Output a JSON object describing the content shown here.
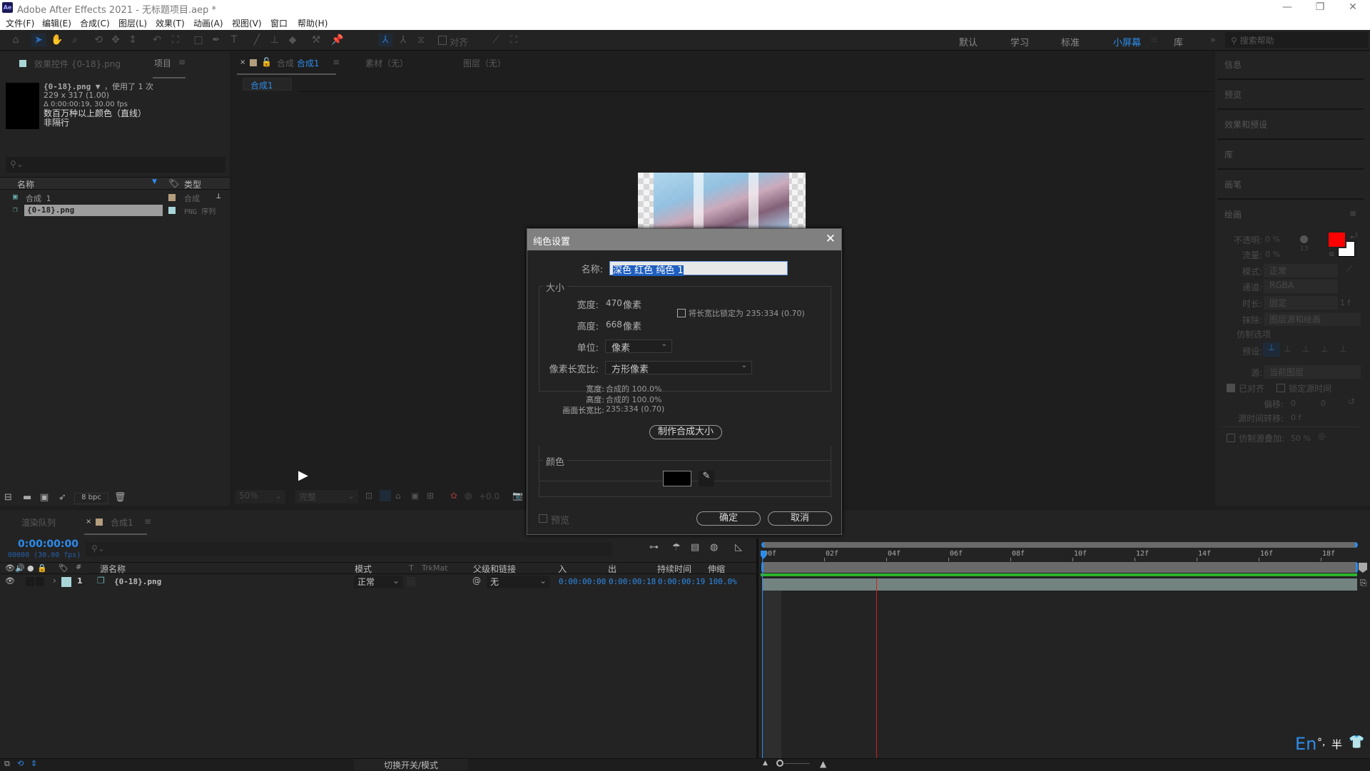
{
  "app": {
    "logo": "Ae",
    "title": "Adobe After Effects 2021 - 无标题项目.aep *",
    "window_buttons": [
      "minimize",
      "restore",
      "close"
    ]
  },
  "menu": [
    "文件(F)",
    "编辑(E)",
    "合成(C)",
    "图层(L)",
    "效果(T)",
    "动画(A)",
    "视图(V)",
    "窗口",
    "帮助(H)"
  ],
  "toolbar": {
    "tools": [
      "home",
      "selection",
      "hand",
      "zoom",
      "orbit",
      "pan",
      "dolly",
      "rotate",
      "anchor",
      "rectangle",
      "pen",
      "text",
      "brush",
      "clone-stamp",
      "eraser",
      "roto-brush",
      "puppet-pin"
    ],
    "align_label": "对齐",
    "workspaces": [
      "默认",
      "学习",
      "标准",
      "小屏幕",
      "库"
    ],
    "active_workspace": "小屏幕",
    "overflow": "»",
    "help_placeholder": "搜索帮助"
  },
  "project_panel": {
    "tabs": [
      "效果控件 {0-18}.png",
      "项目"
    ],
    "active_tab": "项目",
    "info": {
      "name": "{0-18}.png ▼",
      "used": "，使用了 1 次",
      "dims": "229 x 317 (1.00)",
      "duration": "Δ 0:00:00:19, 30.00 fps",
      "color": "数百万种以上颜色（直线）",
      "interlace": "非隔行"
    },
    "search_placeholder": "",
    "columns": [
      "名称",
      "类型"
    ],
    "items": [
      {
        "name": "合成 1",
        "type": "合成",
        "label_color": "#b39e7d",
        "selected": false
      },
      {
        "name": "{0-18}.png",
        "type": "PNG 序列",
        "label_color": "#a8d5d8",
        "selected": true
      }
    ],
    "bpc": "8 bpc"
  },
  "comp_viewer": {
    "tabs": [
      "合成 合成1",
      "素材（无）",
      "图层（无）"
    ],
    "comp_prefix": "合成",
    "comp_name": "合成1",
    "footage_tab": "素材（无）",
    "layer_tab": "图层（无）",
    "breadcrumb": "合成1",
    "zoom": "50%",
    "resolution": "完整",
    "exposure": "+0.0"
  },
  "right_panel": {
    "sections": [
      "信息",
      "预览",
      "效果和预设",
      "库",
      "画笔",
      "绘画"
    ],
    "paint": {
      "opacity_label": "不透明:",
      "opacity": "0 %",
      "flow_label": "流量:",
      "flow": "0 %",
      "brush_size": "13",
      "fg_color": "#ff0000",
      "bg_color": "#ffffff",
      "mode_label": "模式:",
      "mode": "正常",
      "channel_label": "通道:",
      "channel": "RGBA",
      "duration_label": "时长:",
      "duration": "固定",
      "duration_frames": "1 f",
      "erase_label": "抹除:",
      "erase": "图层源和绘画",
      "clone_options": "仿制选项",
      "preset_label": "预设:",
      "source_label": "源:",
      "source": "当前图层",
      "aligned": "已对齐",
      "aligned_checked": true,
      "lock_time": "锁定源时间",
      "lock_time_checked": false,
      "offset_label": "偏移:",
      "offset_x": "0",
      "offset_y": "0",
      "time_shift_label": "源时间转移:",
      "time_shift": "0 f",
      "overlay_label": "仿制源叠加:",
      "overlay": "50 %",
      "overlay_checked": false
    }
  },
  "dialog": {
    "title": "纯色设置",
    "name_label": "名称:",
    "name_value": "深色 红色 纯色 1",
    "size_group": "大小",
    "width_label": "宽度:",
    "width": "470",
    "unit_px": "像素",
    "height_label": "高度:",
    "height": "668",
    "lock_aspect": "将长宽比锁定为 235:334 (0.70)",
    "lock_aspect_checked": false,
    "units_label": "单位:",
    "units": "像素",
    "par_label": "像素长宽比:",
    "par": "方形像素",
    "pct_width_label": "宽度:",
    "pct_width": "合成的 100.0%",
    "pct_height_label": "高度:",
    "pct_height": "合成的 100.0%",
    "frame_aspect_label": "画面长宽比:",
    "frame_aspect": "235:334 (0.70)",
    "make_comp_size": "制作合成大小",
    "color_group": "颜色",
    "color_value": "#000000",
    "preview_label": "预览",
    "preview_checked": false,
    "ok": "确定",
    "cancel": "取消"
  },
  "timeline": {
    "tabs": [
      "渲染队列",
      "合成1"
    ],
    "active_tab": "合成1",
    "timecode": "0:00:00:00",
    "frame_info": "00000 (30.00 fps)",
    "columns": [
      "源名称",
      "模式",
      "T",
      "TrkMat",
      "父级和链接",
      "入",
      "出",
      "持续时间",
      "伸缩"
    ],
    "layers": [
      {
        "index": "1",
        "name": "{0-18}.png",
        "mode": "正常",
        "parent": "无",
        "in": "0:00:00:00",
        "out": "0:00:00:18",
        "duration": "0:00:00:19",
        "stretch": "100.0%",
        "label_color": "#a8d5d8"
      }
    ],
    "ruler": [
      "00f",
      "02f",
      "04f",
      "06f",
      "08f",
      "10f",
      "12f",
      "14f",
      "16f",
      "18f"
    ],
    "toggle_label": "切换开关/模式"
  },
  "input_method": {
    "lang": "En",
    "punct": "°,",
    "width": "半"
  }
}
